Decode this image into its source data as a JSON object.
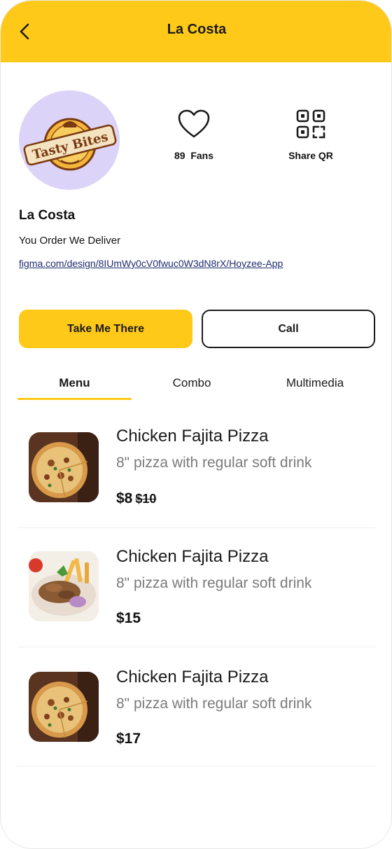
{
  "header": {
    "title": "La Costa"
  },
  "profile": {
    "logo_text": "Tasty Bites",
    "name": "La Costa",
    "tagline": "You Order We Deliver",
    "link": "figma.com/design/8IUmWy0cV0fwuc0W3dN8rX/Hoyzee-App"
  },
  "stats": {
    "fans_label": "89  Fans",
    "qr_label": "Share QR"
  },
  "actions": {
    "primary_label": "Take Me There",
    "secondary_label": "Call"
  },
  "tabs": [
    {
      "label": "Menu",
      "active": true
    },
    {
      "label": "Combo",
      "active": false
    },
    {
      "label": "Multimedia",
      "active": false
    }
  ],
  "menu_items": [
    {
      "name": "Chicken Fajita Pizza",
      "description": "8\" pizza with regular soft drink",
      "price": "$8",
      "old_price": "$10"
    },
    {
      "name": "Chicken Fajita Pizza",
      "description": "8\" pizza with regular soft drink",
      "price": "$15"
    },
    {
      "name": "Chicken Fajita Pizza",
      "description": "8\" pizza with regular soft drink",
      "price": "$17"
    }
  ],
  "colors": {
    "accent": "#FFC91A",
    "avatar_bg": "#DCD3F8",
    "link": "#1E2C6E"
  }
}
